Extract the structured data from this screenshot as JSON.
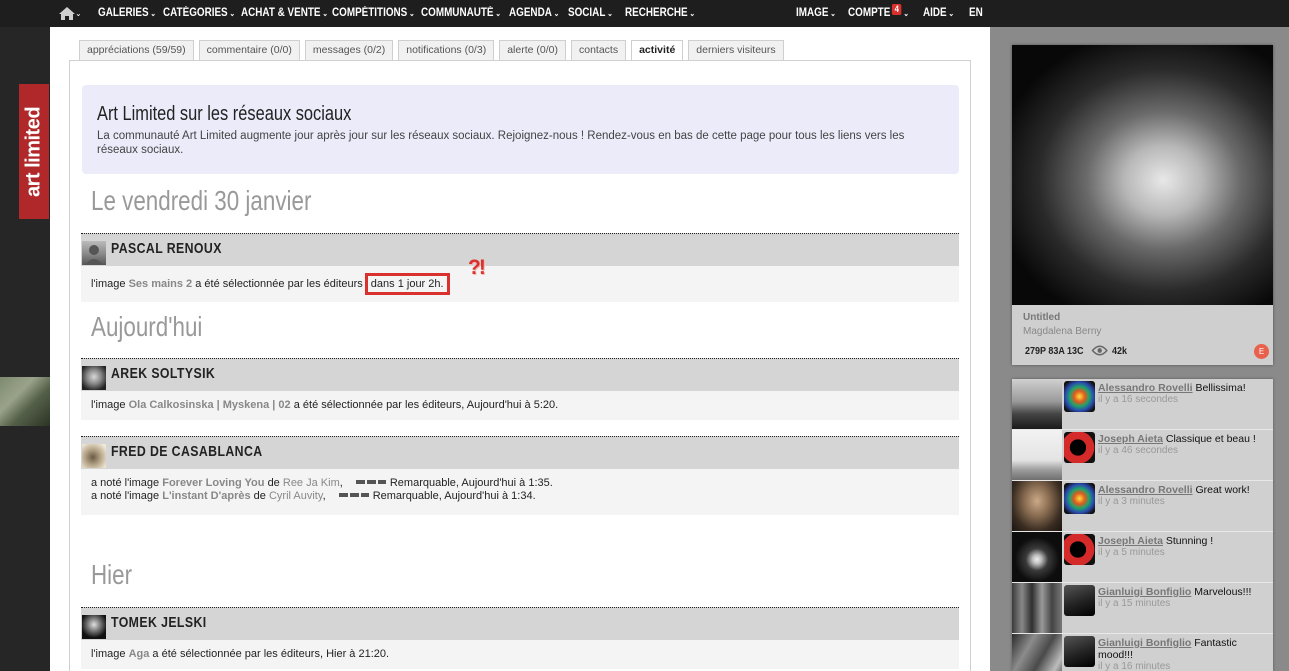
{
  "nav": {
    "left_items": [
      {
        "label": "GALERIES",
        "caret": "⌄"
      },
      {
        "label": "CATÉGORIES",
        "caret": "⌄"
      },
      {
        "label": "ACHAT & VENTE",
        "caret": "⌄"
      },
      {
        "label": "COMPÉTITIONS",
        "caret": "⌄"
      },
      {
        "label": "COMMUNAUTÉ",
        "caret": "⌄"
      },
      {
        "label": "AGENDA",
        "caret": "⌄"
      },
      {
        "label": "SOCIAL",
        "caret": "⌄"
      },
      {
        "label": "RECHERCHE",
        "caret": "⌄"
      }
    ],
    "image": "IMAGE",
    "compte": "COMPTE",
    "compte_badge": "4",
    "aide": "AIDE",
    "lang": "EN",
    "caret": "⌄"
  },
  "logo": "art limited",
  "tabs": [
    "appréciations (59/59)",
    "commentaire (0/0)",
    "messages (0/2)",
    "notifications (0/3)",
    "alerte (0/0)",
    "contacts",
    "activité",
    "derniers visiteurs"
  ],
  "active_tab": "activité",
  "announcement": {
    "title": "Art Limited sur les réseaux sociaux",
    "text": "La communauté Art Limited augmente jour après jour sur les réseaux sociaux. Rejoignez-nous ! Rendez-vous en bas de cette page pour tous les liens vers les réseaux sociaux."
  },
  "days": {
    "d1": "Le vendredi 30 janvier",
    "d2": "Aujourd'hui",
    "d3": "Hier"
  },
  "entries": {
    "pascal": {
      "name": "PASCAL RENOUX",
      "pre": "l'image",
      "image": "Ses mains 2",
      "mid": "a été sélectionnée par les éditeurs",
      "when": "dans 1 jour 2h."
    },
    "arek": {
      "name": "AREK SOLTYSIK",
      "pre": "l'image",
      "image": "Ola Calkosinska | Myskena | 02",
      "post": "a été sélectionnée par les éditeurs, Aujourd'hui à 5:20."
    },
    "fred": {
      "name": "FRED DE CASABLANCA",
      "line1": {
        "pre": "a noté l'image",
        "image": "Forever Loving You",
        "de": "de",
        "author": "Ree Ja Kim",
        "post": "Remarquable, Aujourd'hui à 1:35."
      },
      "line2": {
        "pre": "a noté l'image",
        "image": "L'instant D'après",
        "de": "de",
        "author": "Cyril Auvity",
        "post": "Remarquable, Aujourd'hui à 1:34."
      }
    },
    "tomek": {
      "name": "TOMEK JELSKI",
      "pre": "l'image",
      "image": "Aga",
      "post": "a été sélectionnée par les éditeurs, Hier à 21:20."
    }
  },
  "annotation": "?!",
  "featured": {
    "title": "Untitled",
    "author": "Magdalena Berny",
    "stats": "279P 83A 13C",
    "views": "42k",
    "badge": "E"
  },
  "feed": [
    {
      "user": "Alessandro Rovelli",
      "comment": "Bellissima!",
      "time": "il y a 16 secondes"
    },
    {
      "user": "Joseph Aieta",
      "comment": "Classique et beau !",
      "time": "il y a 46 secondes"
    },
    {
      "user": "Alessandro Rovelli",
      "comment": "Great work!",
      "time": "il y a 3 minutes"
    },
    {
      "user": "Joseph Aieta",
      "comment": "Stunning !",
      "time": "il y a 5 minutes"
    },
    {
      "user": "Gianluigi Bonfiglio",
      "comment": "Marvelous!!!",
      "time": "il y a 15 minutes"
    },
    {
      "user": "Gianluigi Bonfiglio",
      "comment": "Fantastic mood!!!",
      "time": "il y a 16 minutes"
    }
  ],
  "colors": {
    "accent": "#d9322e",
    "logo_bg": "#b0282a",
    "nav_bg": "#1e1e1e"
  }
}
